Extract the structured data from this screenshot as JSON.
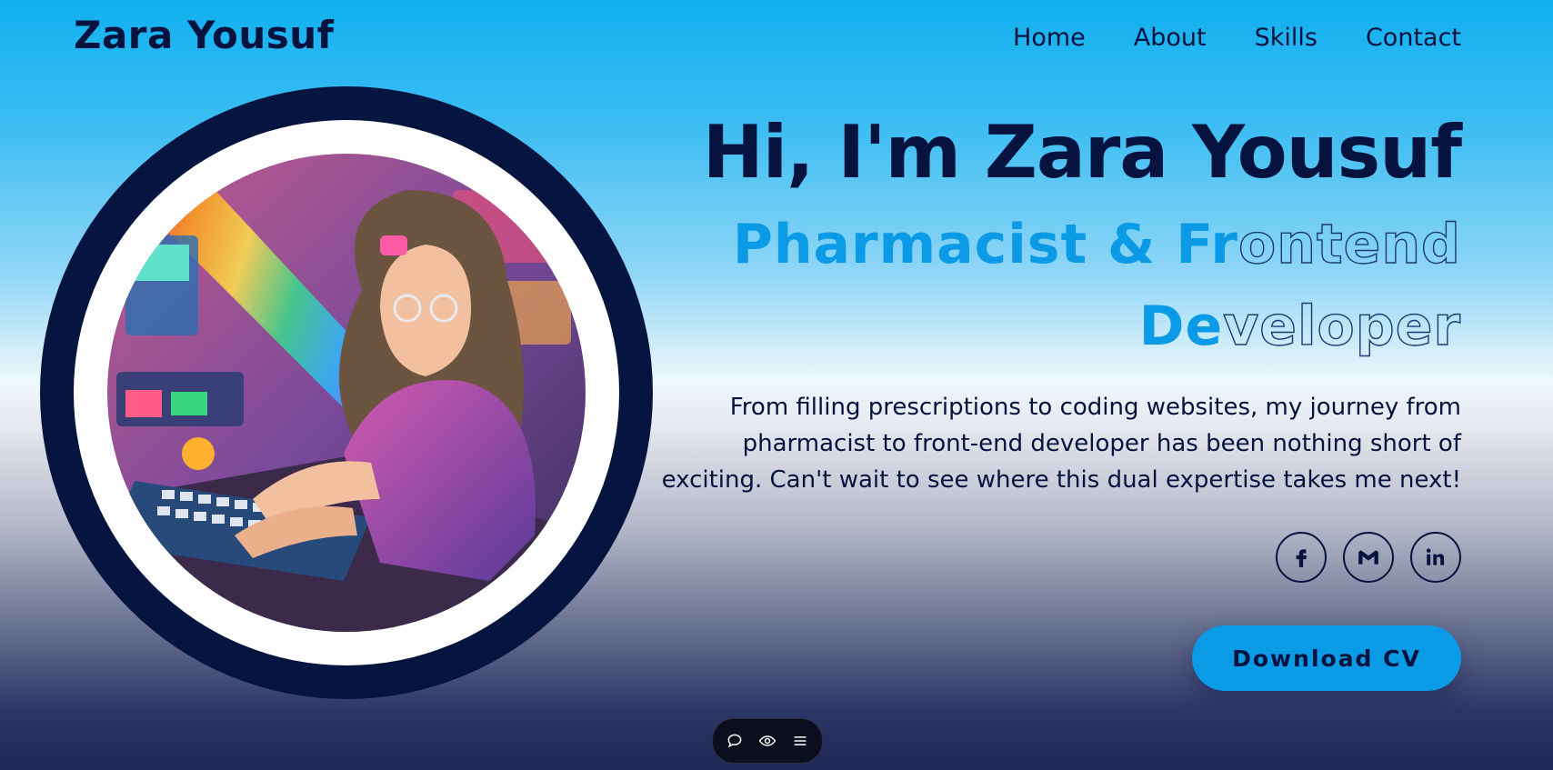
{
  "header": {
    "logo": "Zara Yousuf",
    "nav": [
      "Home",
      "About",
      "Skills",
      "Contact"
    ]
  },
  "hero": {
    "greeting": "Hi, I'm Zara Yousuf",
    "subtitle_line1_filled": "Pharmacist & Fr",
    "subtitle_line1_outline": "ontend",
    "subtitle_line2_filled": "De",
    "subtitle_line2_outline": "veloper",
    "intro": "From filling prescriptions to coding websites, my journey from pharmacist to front-end developer has been nothing short of exciting. Can't wait to see where this dual expertise takes me next!",
    "cta_label": "Download CV"
  },
  "socials": [
    {
      "icon": "facebook-icon"
    },
    {
      "icon": "gmail-icon"
    },
    {
      "icon": "linkedin-icon"
    }
  ],
  "toolbar": {
    "icons": [
      "chat-bubble-icon",
      "eye-icon",
      "menu-icon"
    ]
  },
  "colors": {
    "navy": "#06133f",
    "accent": "#0a9ae6",
    "sky": "#10b0f0"
  }
}
